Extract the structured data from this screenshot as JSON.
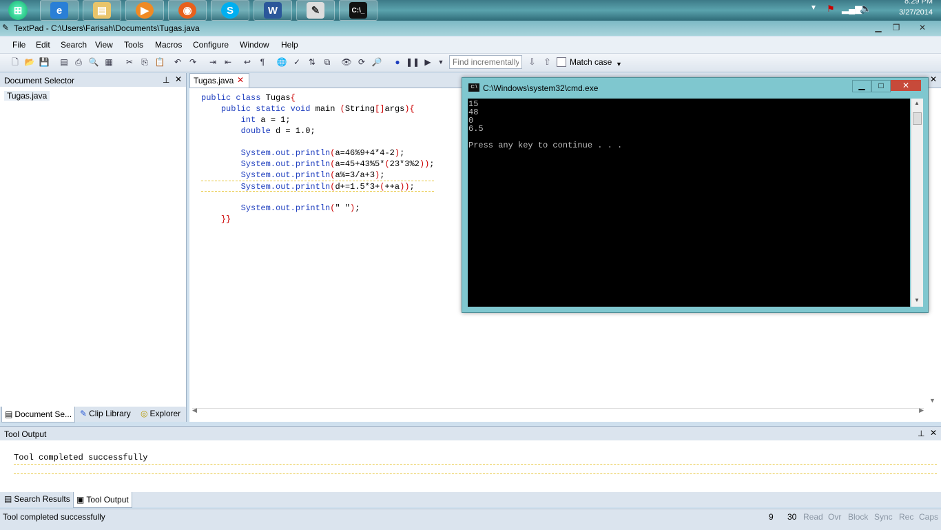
{
  "taskbar": {
    "clock_time": "8:29 PM",
    "clock_date": "3/27/2014"
  },
  "window": {
    "title": "TextPad - C:\\Users\\Farisah\\Documents\\Tugas.java"
  },
  "menu": [
    "File",
    "Edit",
    "Search",
    "View",
    "Tools",
    "Macros",
    "Configure",
    "Window",
    "Help"
  ],
  "toolbar": {
    "find_placeholder": "Find incrementally",
    "match_case_label": "Match case"
  },
  "document_selector": {
    "title": "Document Selector",
    "files": [
      "Tugas.java"
    ],
    "tabs": [
      "Document Se...",
      "Clip Library",
      "Explorer"
    ]
  },
  "editor": {
    "tab_label": "Tugas.java",
    "lines": [
      "public class Tugas{",
      "    public static void main (String[]args){",
      "        int a = 1;",
      "        double d = 1.0;",
      "",
      "        System.out.println(a=46%9+4*4-2);",
      "        System.out.println(a=45+43%5*(23*3%2));",
      "        System.out.println(a%=3/a+3);",
      "        System.out.println(d+=1.5*3+(++a));",
      "",
      "        System.out.println(\" \");",
      "    }}"
    ]
  },
  "cmd": {
    "title": "C:\\Windows\\system32\\cmd.exe",
    "output": [
      "15",
      "48",
      "0",
      "6.5",
      "",
      "Press any key to continue . . ."
    ]
  },
  "tool_output": {
    "title": "Tool Output",
    "message": "Tool completed successfully",
    "tabs": [
      "Search Results",
      "Tool Output"
    ]
  },
  "statusbar": {
    "message": "Tool completed successfully",
    "line": "9",
    "column": "30",
    "flags": [
      "Read",
      "Ovr",
      "Block",
      "Sync",
      "Rec",
      "Caps"
    ]
  }
}
